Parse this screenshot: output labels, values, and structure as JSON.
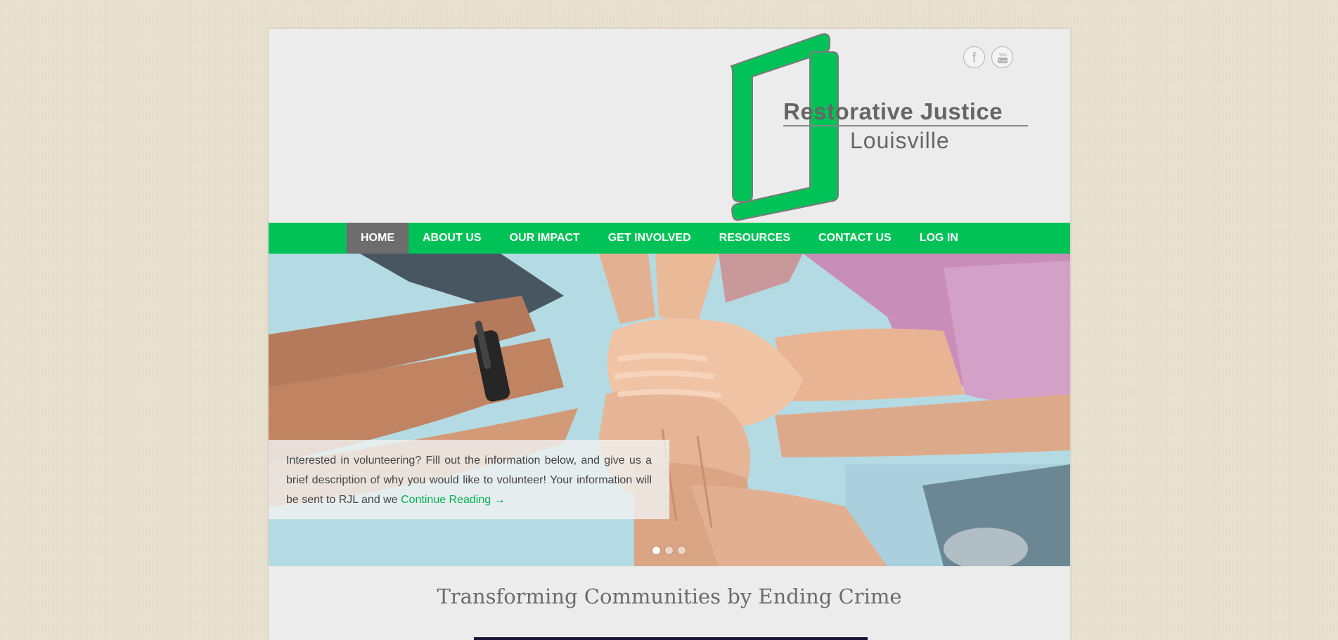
{
  "site": {
    "logo_title": "Restorative Justice",
    "logo_subtitle": "Louisville",
    "brand_color": "#00c257",
    "text_color": "#666666"
  },
  "social": [
    {
      "name": "facebook",
      "icon": "facebook-icon",
      "glyph": "f"
    },
    {
      "name": "youtube",
      "icon": "youtube-icon",
      "glyph": "You Tube"
    }
  ],
  "nav": {
    "items": [
      {
        "label": "HOME",
        "active": true
      },
      {
        "label": "ABOUT US",
        "active": false
      },
      {
        "label": "OUR IMPACT",
        "active": false
      },
      {
        "label": "GET INVOLVED",
        "active": false
      },
      {
        "label": "RESOURCES",
        "active": false
      },
      {
        "label": "CONTACT US",
        "active": false
      },
      {
        "label": "LOG IN",
        "active": false
      }
    ],
    "active_color": "#6d6d6d"
  },
  "hero": {
    "caption_text": "Interested in volunteering? Fill out the information below, and give us a brief description of why you would like to volunteer! Your information will be sent to RJL and we ",
    "continue_label": "Continue Reading →",
    "slides_total": 3,
    "slide_active": 1
  },
  "main": {
    "tagline": "Transforming Communities by Ending Crime"
  }
}
